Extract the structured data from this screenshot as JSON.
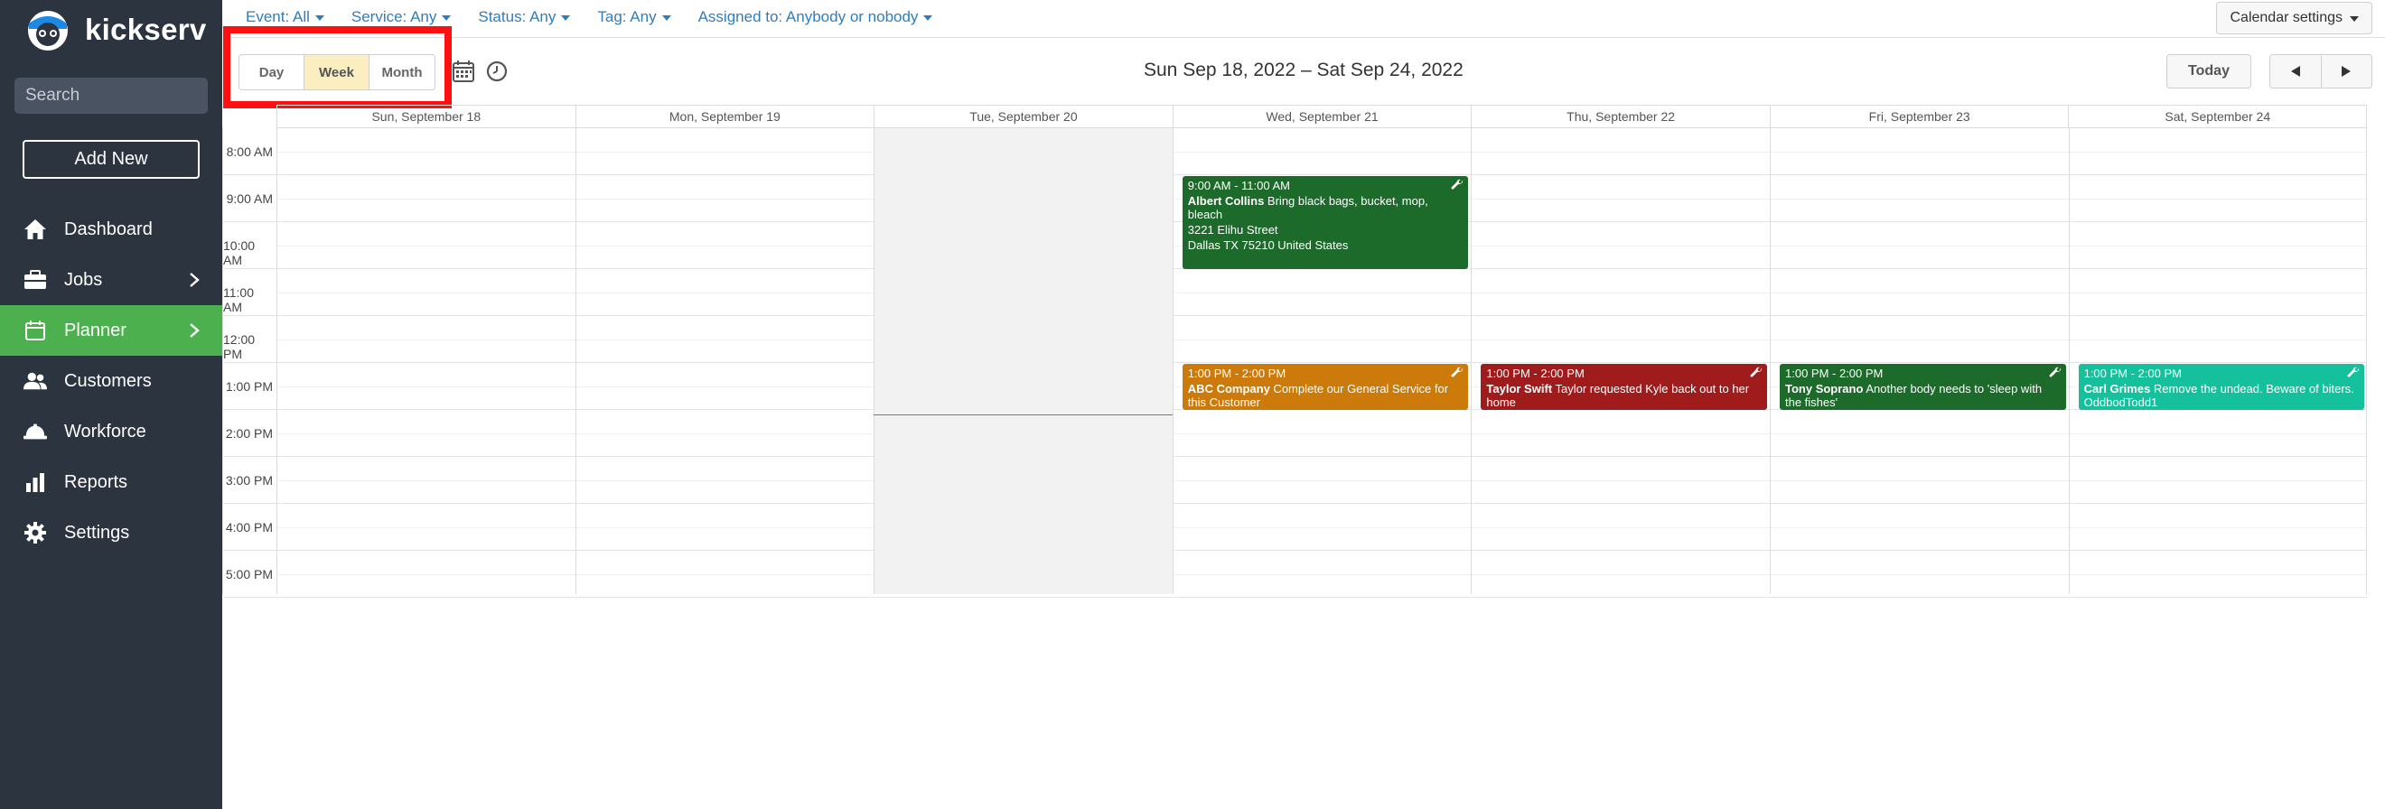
{
  "app": {
    "name": "kickserv"
  },
  "sidebar": {
    "search_placeholder": "Search",
    "add_new_label": "Add New",
    "items": [
      {
        "label": "Dashboard",
        "icon": "home-icon",
        "active": false
      },
      {
        "label": "Jobs",
        "icon": "briefcase-icon",
        "active": false,
        "chevron": true
      },
      {
        "label": "Planner",
        "icon": "calendar-icon",
        "active": true,
        "chevron": true
      },
      {
        "label": "Customers",
        "icon": "users-icon",
        "active": false
      },
      {
        "label": "Workforce",
        "icon": "hardhat-icon",
        "active": false
      },
      {
        "label": "Reports",
        "icon": "bar-chart-icon",
        "active": false
      },
      {
        "label": "Settings",
        "icon": "gear-icon",
        "active": false
      }
    ]
  },
  "filters": {
    "event": "Event: All",
    "service": "Service: Any",
    "status": "Status: Any",
    "tag": "Tag: Any",
    "assigned": "Assigned to: Anybody or nobody"
  },
  "calendar_settings_label": "Calendar settings",
  "toolbar": {
    "views": [
      "Day",
      "Week",
      "Month"
    ],
    "active_view": "Week",
    "date_range": "Sun Sep 18, 2022 – Sat Sep 24, 2022",
    "today_label": "Today"
  },
  "days": [
    "Sun, September 18",
    "Mon, September 19",
    "Tue, September 20",
    "Wed, September 21",
    "Thu, September 22",
    "Fri, September 23",
    "Sat, September 24"
  ],
  "today_index": 2,
  "times": [
    "8:00 AM",
    "9:00 AM",
    "10:00 AM",
    "11:00 AM",
    "12:00 PM",
    "1:00 PM",
    "2:00 PM",
    "3:00 PM",
    "4:00 PM",
    "5:00 PM"
  ],
  "events": [
    {
      "day": 3,
      "start": 9,
      "end": 11,
      "color": "#1d6b2a",
      "time": "9:00 AM - 11:00 AM",
      "name": "Albert Collins",
      "desc": "Bring black bags, bucket, mop, bleach",
      "address1": "3221 Elihu Street",
      "address2": "Dallas TX 75210 United States"
    },
    {
      "day": 3,
      "start": 13,
      "end": 14,
      "color": "#cc7a0a",
      "time": "1:00 PM - 2:00 PM",
      "name": "ABC Company",
      "desc": "Complete our General Service for this Customer"
    },
    {
      "day": 4,
      "start": 13,
      "end": 14,
      "color": "#a01c1c",
      "time": "1:00 PM - 2:00 PM",
      "name": "Taylor Swift",
      "desc": "Taylor requested Kyle back out to her home"
    },
    {
      "day": 5,
      "start": 13,
      "end": 14,
      "color": "#1d6b2a",
      "time": "1:00 PM - 2:00 PM",
      "name": "Tony Soprano",
      "desc": "Another body needs to 'sleep with the fishes'"
    },
    {
      "day": 6,
      "start": 13,
      "end": 14,
      "color": "#14c19c",
      "time": "1:00 PM - 2:00 PM",
      "name": "Carl Grimes",
      "desc": "Remove the undead. Beware of biters. OddbodTodd1"
    }
  ],
  "now_hour": 14.1
}
